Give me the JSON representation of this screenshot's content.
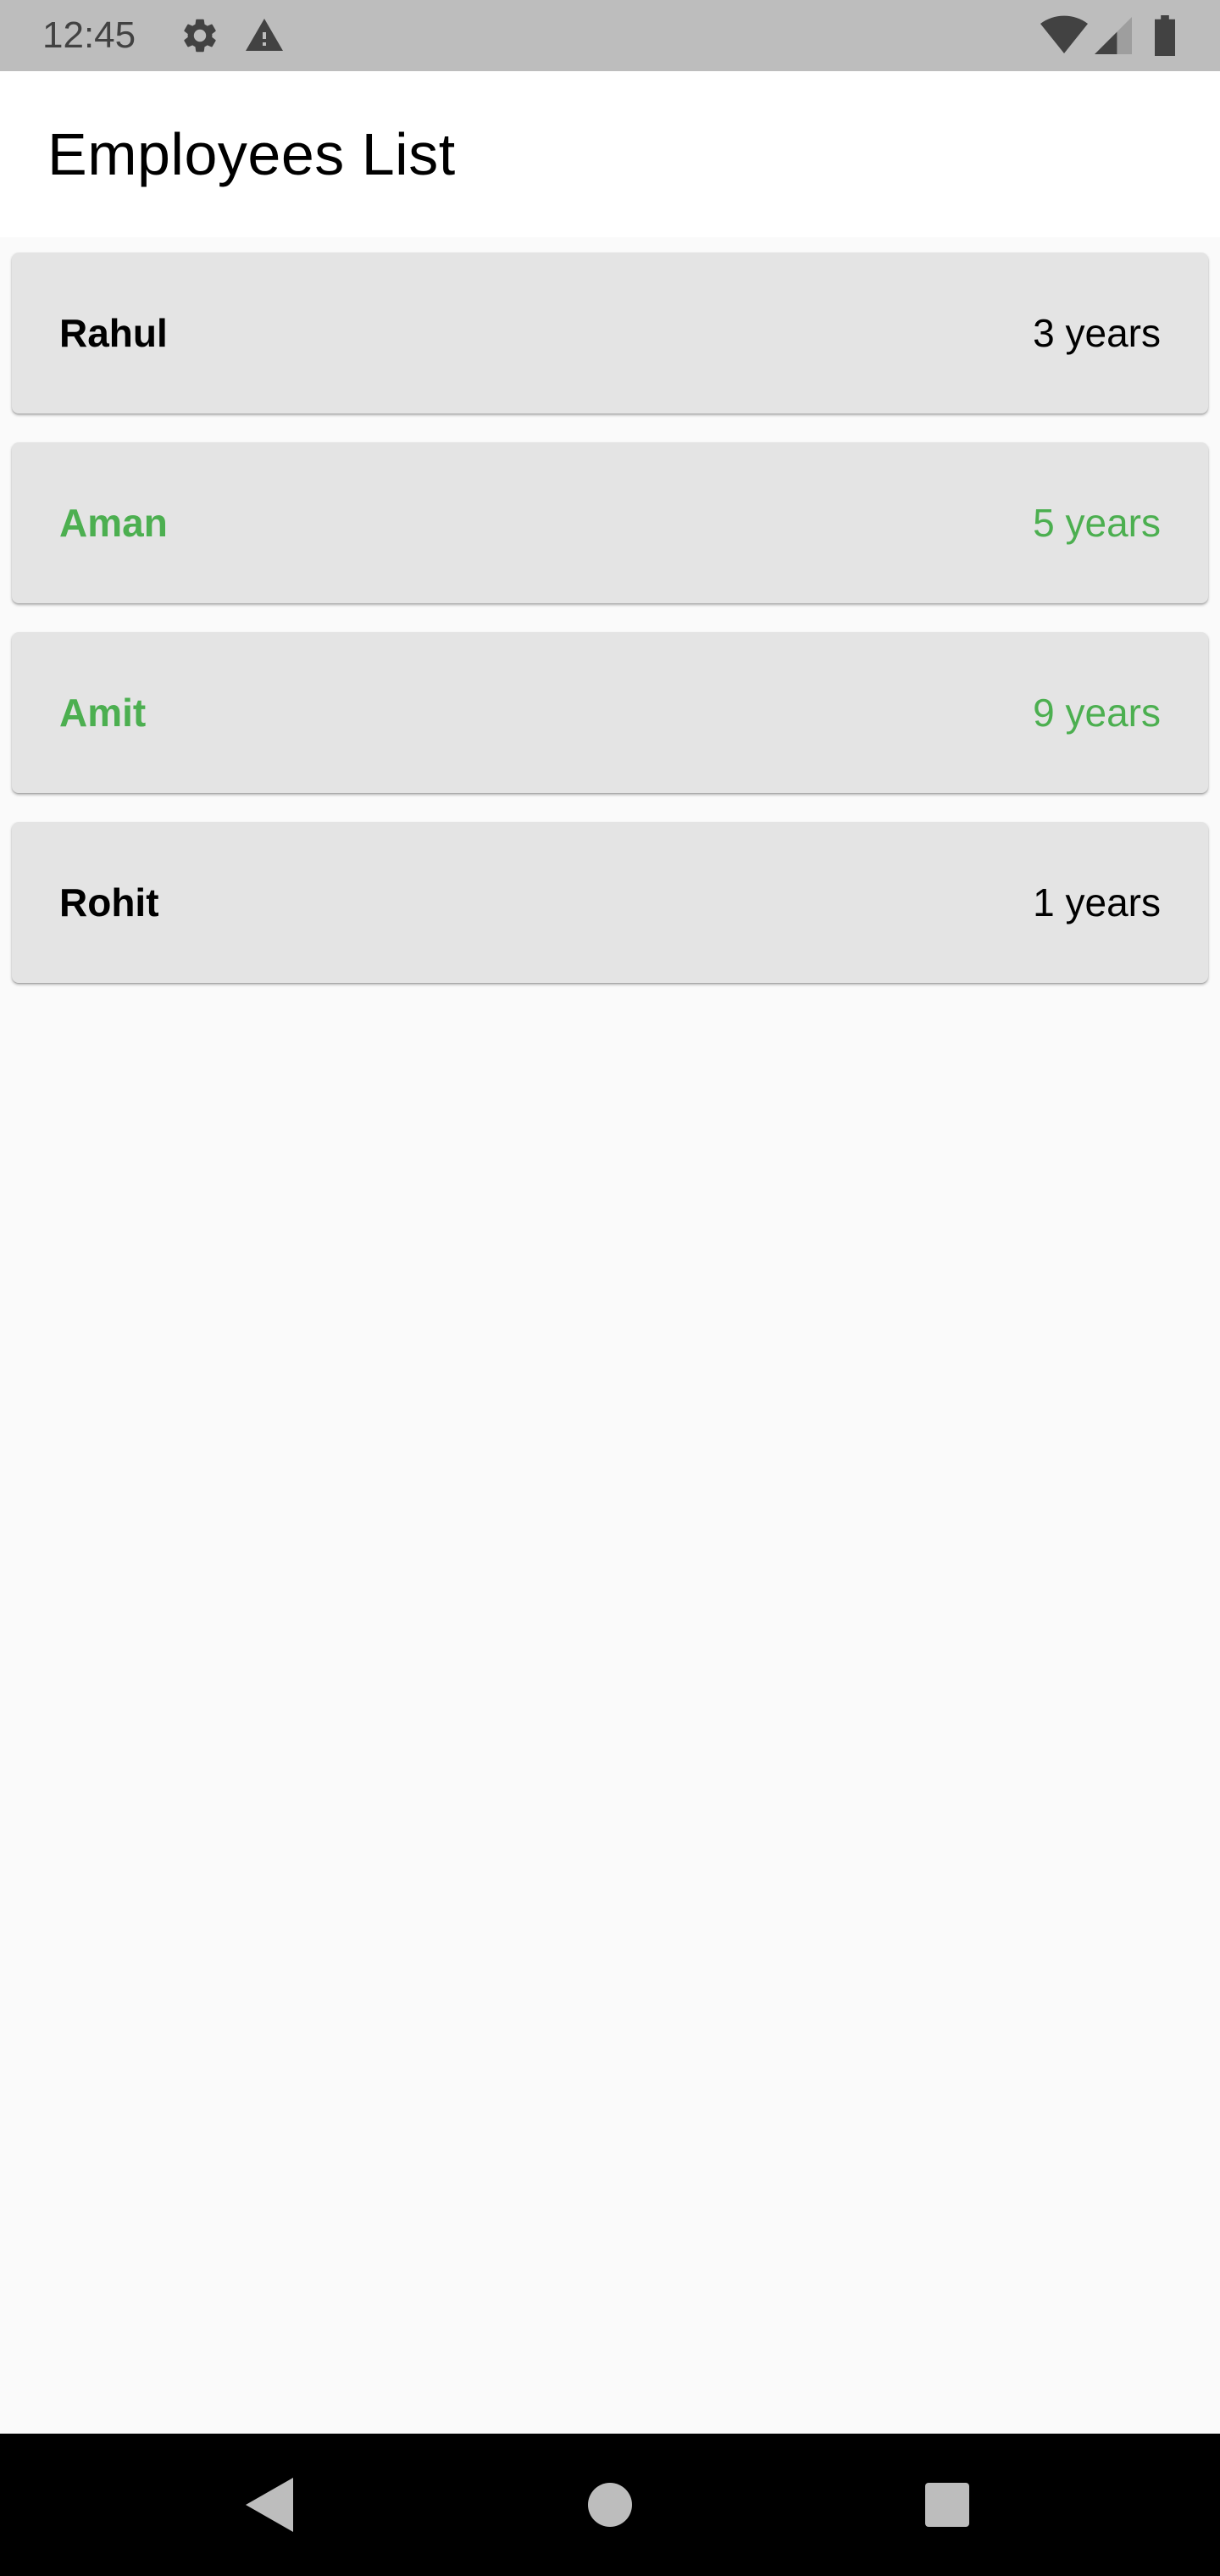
{
  "status_bar": {
    "time": "12:45",
    "icons_left": [
      "gear-icon",
      "warning-icon"
    ],
    "icons_right": [
      "wifi-icon",
      "signal-icon",
      "battery-icon"
    ]
  },
  "app_bar": {
    "title": "Employees List"
  },
  "employees": [
    {
      "name": "Rahul",
      "years": "3 years",
      "color": "#000000"
    },
    {
      "name": "Aman",
      "years": "5 years",
      "color": "#4caf50"
    },
    {
      "name": "Amit",
      "years": "9 years",
      "color": "#4caf50"
    },
    {
      "name": "Rohit",
      "years": "1 years",
      "color": "#000000"
    }
  ],
  "nav_bar": {
    "buttons": [
      "back-icon",
      "home-icon",
      "recents-icon"
    ]
  },
  "colors": {
    "status_bar_bg": "#bdbdbd",
    "app_bar_bg": "#ffffff",
    "page_bg": "#fafafa",
    "card_bg": "#e4e4e4",
    "accent_green": "#4caf50"
  }
}
